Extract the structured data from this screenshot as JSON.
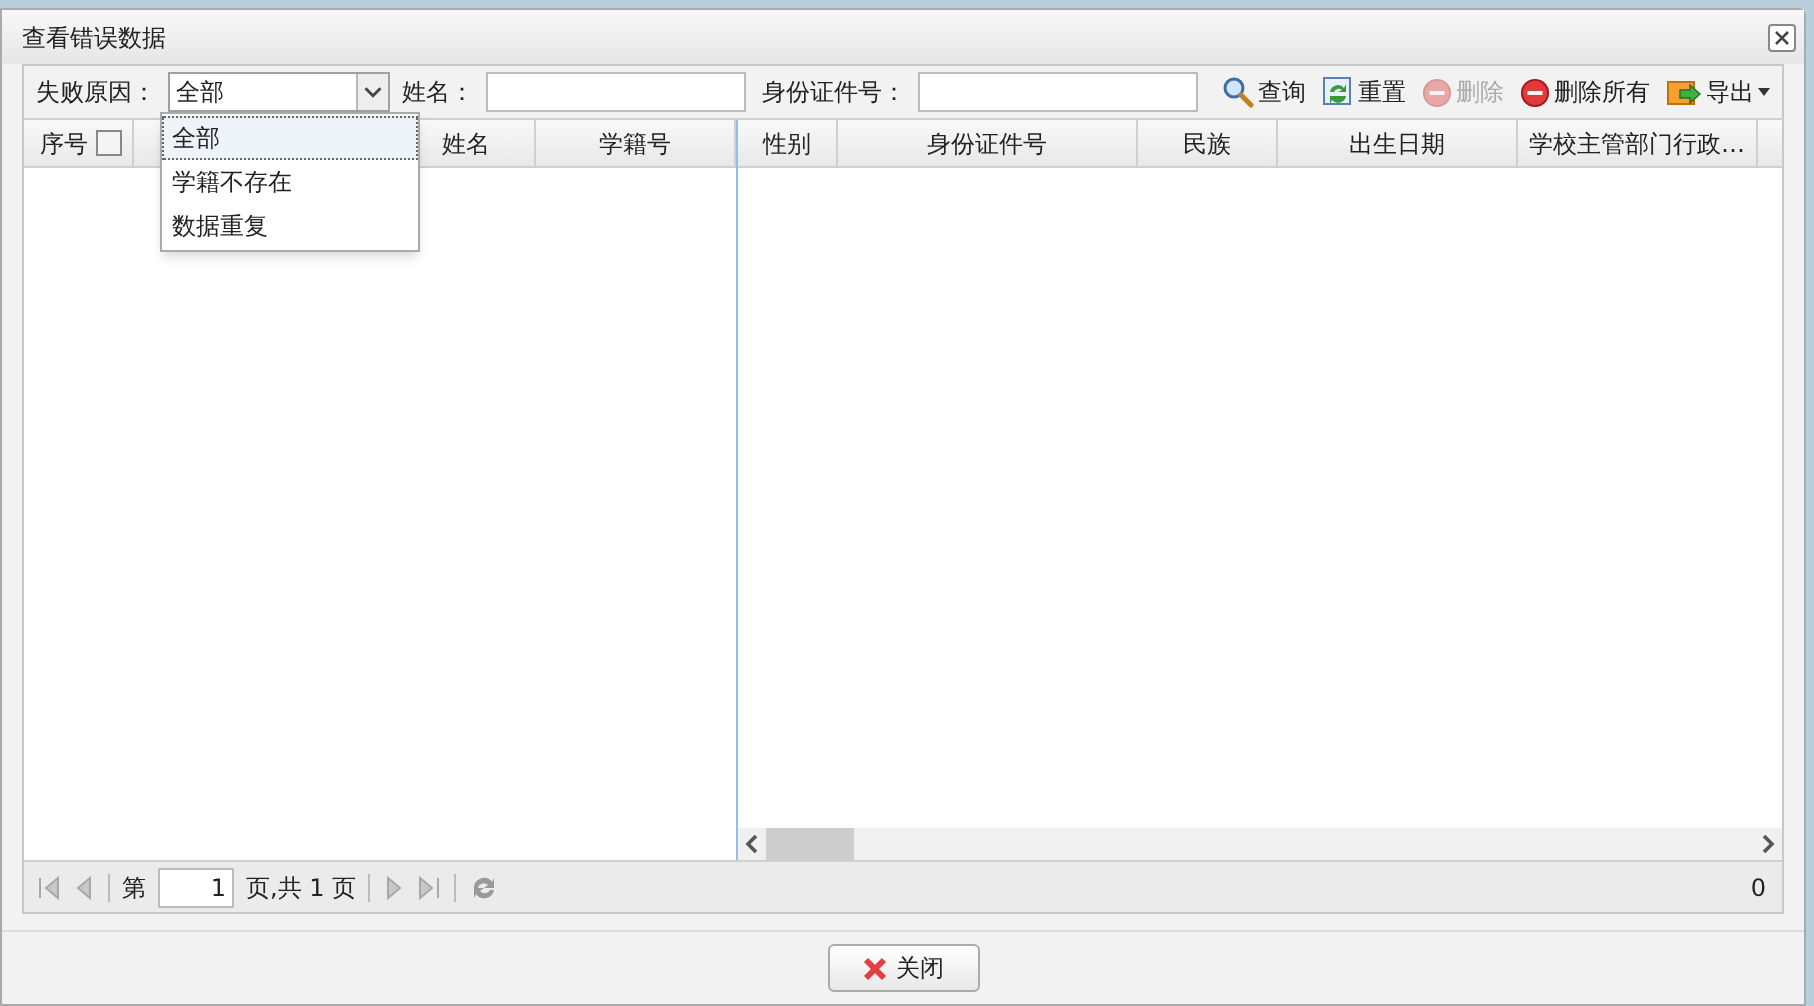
{
  "window": {
    "title": "查看错误数据"
  },
  "filters": {
    "reason": {
      "label": "失败原因：",
      "value": "全部",
      "options": [
        {
          "label": "全部",
          "selected": true
        },
        {
          "label": "学籍不存在",
          "selected": false
        },
        {
          "label": "数据重复",
          "selected": false
        }
      ]
    },
    "name": {
      "label": "姓名："
    },
    "id_number": {
      "label": "身份证件号："
    }
  },
  "toolbar": [
    {
      "kind": "search",
      "label": "查询",
      "disabled": false
    },
    {
      "kind": "reset",
      "label": "重置",
      "disabled": false
    },
    {
      "kind": "delete",
      "label": "删除",
      "disabled": true
    },
    {
      "kind": "delete",
      "label": "删除所有",
      "disabled": false
    },
    {
      "kind": "export",
      "label": "导出",
      "disabled": false
    }
  ],
  "table": {
    "select_all": {
      "checked": false
    },
    "left_columns": [
      "序号",
      "姓名",
      "学籍号"
    ],
    "right_columns": [
      "性别",
      "身份证件号",
      "民族",
      "出生日期",
      "学校主管部门行政…"
    ]
  },
  "pager": {
    "page_prefix": "第",
    "page": "1",
    "page_suffix": "页,共 1 页",
    "total": "0"
  },
  "buttons": [
    {
      "label": "关闭"
    }
  ]
}
